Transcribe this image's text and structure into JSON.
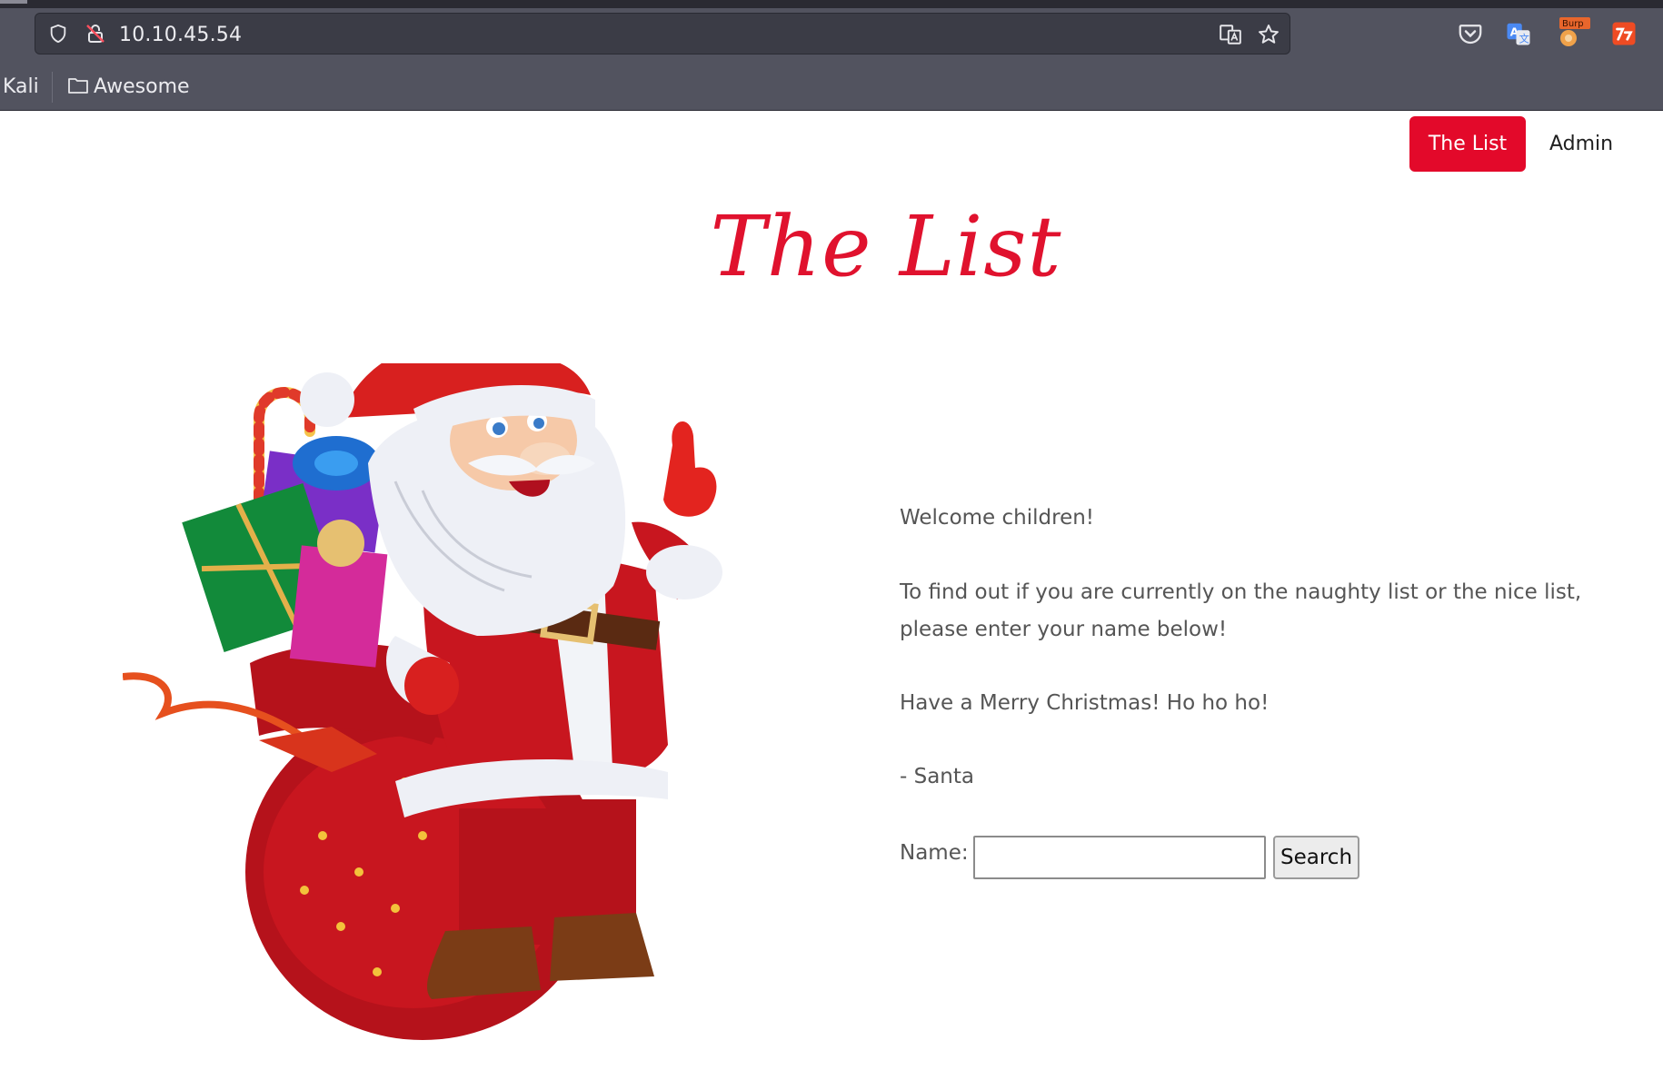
{
  "browser": {
    "url": "10.10.45.54",
    "bookmarks": [
      {
        "label": "Kali"
      },
      {
        "label": "Awesome"
      }
    ],
    "extension_badge": "Burp"
  },
  "nav": {
    "items": [
      {
        "label": "The List",
        "active": true
      },
      {
        "label": "Admin",
        "active": false
      }
    ],
    "active_color": "#e3092a"
  },
  "page": {
    "title": "The List",
    "title_color": "#e0122e",
    "paragraphs": {
      "welcome": "Welcome children!",
      "find": "To find out if you are currently on the naughty list or the nice list, please enter your name below!",
      "merry": "Have a Merry Christmas! Ho ho ho!",
      "signature": "- Santa"
    },
    "form": {
      "name_label": "Name:",
      "name_value": "",
      "search_label": "Search"
    },
    "image": "santa-claus-with-gift-sack"
  }
}
